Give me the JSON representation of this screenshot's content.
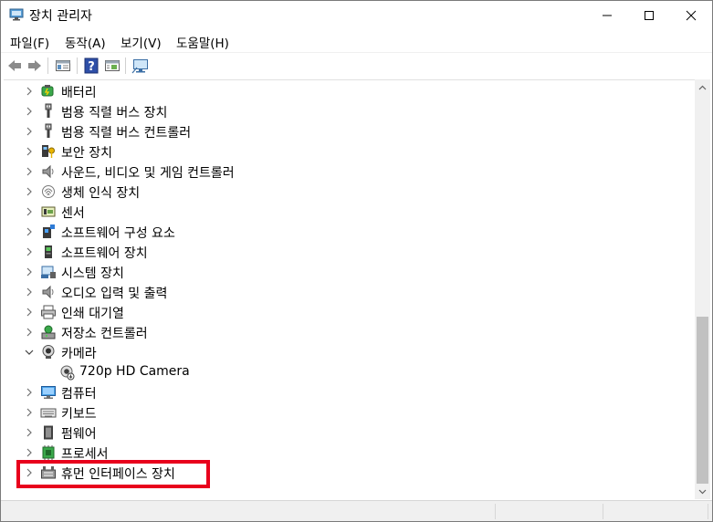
{
  "window": {
    "title": "장치 관리자"
  },
  "menu": {
    "items": [
      {
        "label": "파일(F)"
      },
      {
        "label": "동작(A)"
      },
      {
        "label": "보기(V)"
      },
      {
        "label": "도움말(H)"
      }
    ]
  },
  "toolbar": {
    "icons": [
      "back-arrow-icon",
      "forward-arrow-icon",
      "properties-panel-icon",
      "help-icon",
      "view-panel-icon",
      "monitor-scan-icon"
    ]
  },
  "tree": {
    "items": [
      {
        "label": "배터리",
        "icon": "battery-icon",
        "expanded": false
      },
      {
        "label": "범용 직렬 버스 장치",
        "icon": "usb-icon",
        "expanded": false
      },
      {
        "label": "범용 직렬 버스 컨트롤러",
        "icon": "usb-icon",
        "expanded": false
      },
      {
        "label": "보안 장치",
        "icon": "security-key-icon",
        "expanded": false
      },
      {
        "label": "사운드, 비디오 및 게임 컨트롤러",
        "icon": "speaker-icon",
        "expanded": false
      },
      {
        "label": "생체 인식 장치",
        "icon": "fingerprint-icon",
        "expanded": false
      },
      {
        "label": "센서",
        "icon": "sensor-icon",
        "expanded": false
      },
      {
        "label": "소프트웨어 구성 요소",
        "icon": "software-component-icon",
        "expanded": false
      },
      {
        "label": "소프트웨어 장치",
        "icon": "software-device-icon",
        "expanded": false
      },
      {
        "label": "시스템 장치",
        "icon": "system-device-icon",
        "expanded": false
      },
      {
        "label": "오디오 입력 및 출력",
        "icon": "speaker-icon",
        "expanded": false
      },
      {
        "label": "인쇄 대기열",
        "icon": "printer-icon",
        "expanded": false
      },
      {
        "label": "저장소 컨트롤러",
        "icon": "storage-controller-icon",
        "expanded": false
      },
      {
        "label": "카메라",
        "icon": "webcam-icon",
        "expanded": true
      },
      {
        "label": "720p HD Camera",
        "icon": "camera-device-icon",
        "child": true
      },
      {
        "label": "컴퓨터",
        "icon": "computer-icon",
        "expanded": false
      },
      {
        "label": "키보드",
        "icon": "keyboard-icon",
        "expanded": false
      },
      {
        "label": "펌웨어",
        "icon": "firmware-icon",
        "expanded": false
      },
      {
        "label": "프로세서",
        "icon": "processor-icon",
        "expanded": false
      },
      {
        "label": "휴먼 인터페이스 장치",
        "icon": "hid-icon",
        "expanded": false,
        "highlighted": true
      }
    ]
  },
  "colors": {
    "highlight": "#e8001c",
    "scroll_thumb": "#c1c1c1"
  }
}
